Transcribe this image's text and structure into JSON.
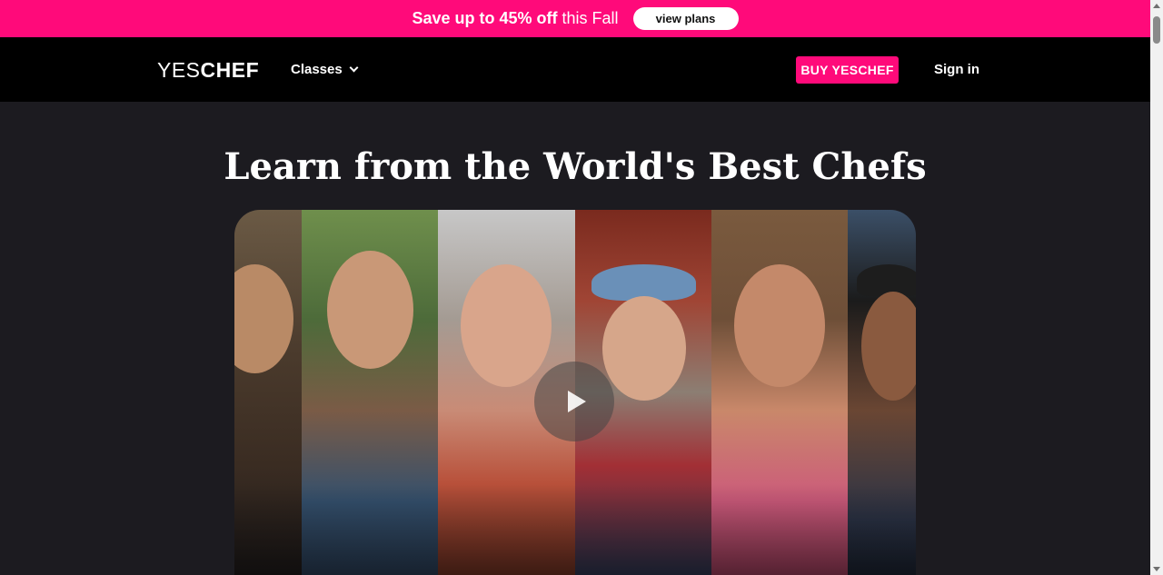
{
  "promo": {
    "bold_text": "Save up to 45% off",
    "regular_text": " this Fall",
    "button_label": "view plans",
    "background_color": "#ff0a7a"
  },
  "nav": {
    "logo_thin": "YES",
    "logo_bold": "CHEF",
    "classes_label": "Classes",
    "buy_label": "BUY YESCHEF",
    "signin_label": "Sign in"
  },
  "hero": {
    "headline": "Learn from the World's Best Chefs",
    "video_icon": "play-icon"
  },
  "colors": {
    "accent": "#ff0a7a",
    "nav_bg": "#000000",
    "page_bg": "#1c1b20"
  }
}
